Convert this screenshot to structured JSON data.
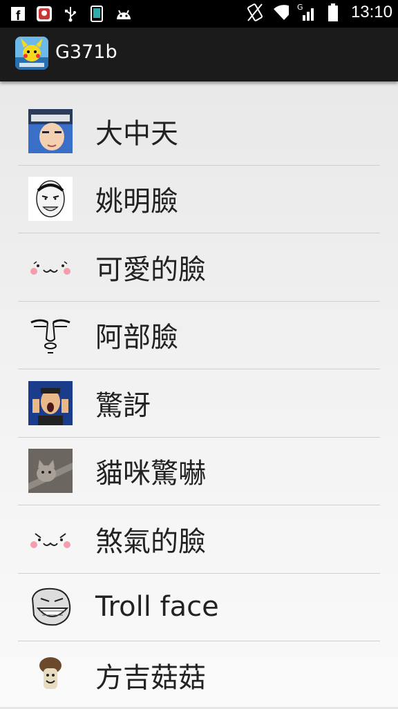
{
  "status_bar": {
    "time": "13:10",
    "left_icons": [
      "facebook-icon",
      "notification-app-icon",
      "usb-icon",
      "phone-icon",
      "android-icon"
    ],
    "right_icons": [
      "rotation-icon",
      "wifi-icon",
      "signal-icon",
      "battery-icon"
    ],
    "network_type": "G"
  },
  "action_bar": {
    "app_title": "G371b"
  },
  "list": {
    "items": [
      {
        "label": "大中天",
        "thumb": "anime-character-thumb"
      },
      {
        "label": "姚明臉",
        "thumb": "yao-ming-face-thumb"
      },
      {
        "label": "可愛的臉",
        "thumb": "cute-face-thumb"
      },
      {
        "label": "阿部臉",
        "thumb": "abe-face-thumb"
      },
      {
        "label": "驚訝",
        "thumb": "surprised-man-thumb"
      },
      {
        "label": "貓咪驚嚇",
        "thumb": "scared-cat-thumb"
      },
      {
        "label": "煞氣的臉",
        "thumb": "fierce-face-thumb"
      },
      {
        "label": "Troll face",
        "thumb": "troll-face-thumb"
      },
      {
        "label": "方吉菇菇",
        "thumb": "mushroom-thumb"
      }
    ]
  }
}
